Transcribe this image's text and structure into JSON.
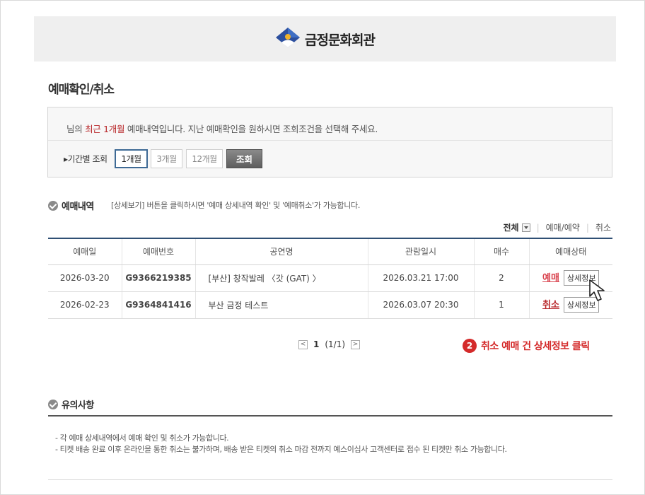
{
  "brand": {
    "name": "금정문화회관",
    "logo_icon": "geumjeong-logo-icon"
  },
  "page": {
    "title": "예매확인/취소"
  },
  "filter": {
    "notice_prefix": "님의 ",
    "notice_highlight": "최근 1개월",
    "notice_suffix": " 예매내역입니다. 지난 예매확인을 원하시면 조회조건을 선택해 주세요.",
    "period_label": "▸기간별 조회",
    "options": [
      "1개월",
      "3개월",
      "12개월"
    ],
    "selected": "1개월",
    "search_label": "조회"
  },
  "history": {
    "title": "예매내역",
    "description": "[상세보기] 버튼을 클릭하시면 '예매 상세내역 확인' 및 '예매취소'가 가능합니다.",
    "status_filter": {
      "all": "전체",
      "book": "예매/예약",
      "cancel": "취소"
    },
    "columns": [
      "예매일",
      "예매번호",
      "공연명",
      "관람일시",
      "매수",
      "예매상태"
    ],
    "rows": [
      {
        "date": "2026-03-20",
        "number": "G9366219385",
        "title": "[부산] 창작발레 〈갓 (GAT) 〉",
        "show_time": "2026.03.21 17:00",
        "qty": "2",
        "status": "예매",
        "detail_label": "상세정보"
      },
      {
        "date": "2026-02-23",
        "number": "G9364841416",
        "title": "부산 금정 테스트",
        "show_time": "2026.03.07 20:30",
        "qty": "1",
        "status": "취소",
        "detail_label": "상세정보"
      }
    ]
  },
  "pagination": {
    "prev": "<",
    "current": "1",
    "summary": "(1/1)",
    "next": ">"
  },
  "callout": {
    "step": "2",
    "text": "취소 예매 건 상세정보 클릭",
    "color": "#d42a2a"
  },
  "caution": {
    "title": "유의사항",
    "items": [
      "- 각 예매 상세내역에서 예매 확인 및 취소가 가능합니다.",
      "- 티켓 배송 완료 이후 온라인을 통한 취소는 불가하며, 배송 받은 티켓의 취소 마감 전까지 예스이십사 고객센터로 접수 된 티켓만 취소 가능합니다."
    ]
  }
}
